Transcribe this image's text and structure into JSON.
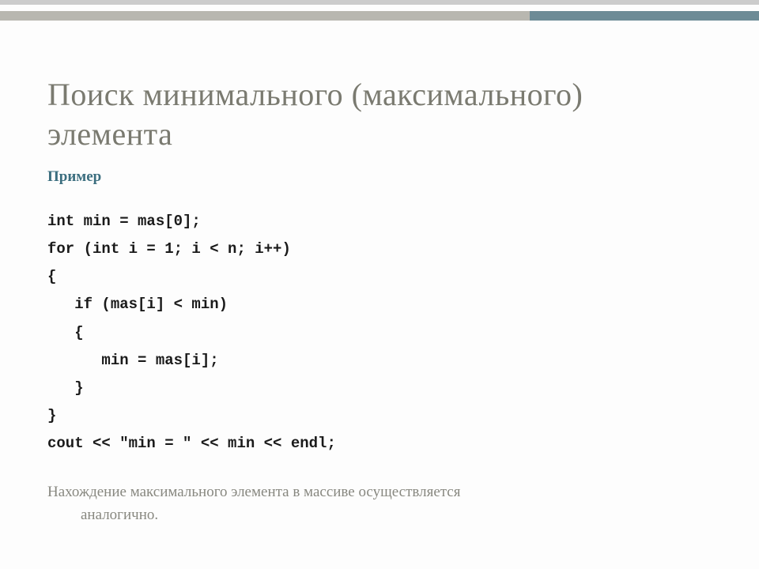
{
  "slide": {
    "title": "Поиск минимального (максимального) элемента",
    "example_label": "Пример",
    "code": "int min = mas[0];\nfor (int i = 1; i < n; i++)\n{\n   if (mas[i] < min)\n   {\n      min = mas[i];\n   }\n}\ncout << \"min = \" << min << endl;",
    "footer_line1": "Нахождение максимального элемента в массиве осуществляется",
    "footer_line2": "аналогично."
  },
  "colors": {
    "title": "#7a7a70",
    "accent": "#3b6e7f",
    "bar_left": "#b8b7b0",
    "bar_right": "#6d8b96"
  }
}
